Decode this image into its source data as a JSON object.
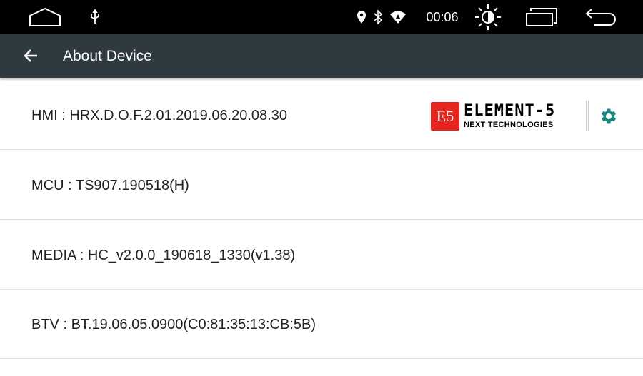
{
  "status_bar": {
    "time": "00:06",
    "icons": [
      "home-icon",
      "usb-icon",
      "location-icon",
      "bluetooth-icon",
      "wifi-icon",
      "brightness-icon",
      "recent-apps-icon",
      "back-icon"
    ]
  },
  "toolbar": {
    "title": "About Device"
  },
  "rows": [
    {
      "text": "HMI : HRX.D.O.F.2.01.2019.06.20.08.30"
    },
    {
      "text": "MCU : TS907.190518(H)"
    },
    {
      "text": "MEDIA : HC_v2.0.0_190618_1330(v1.38)"
    },
    {
      "text": "BTV : BT.19.06.05.0900(C0:81:35:13:CB:5B)"
    }
  ],
  "logo": {
    "badge": "E5",
    "name": "ELEMENT-5",
    "tagline": "NEXT TECHNOLOGIES"
  },
  "colors": {
    "status_bg": "#000000",
    "toolbar_bg": "#2e3a40",
    "gear": "#16887e",
    "logo_red": "#e8241f"
  }
}
